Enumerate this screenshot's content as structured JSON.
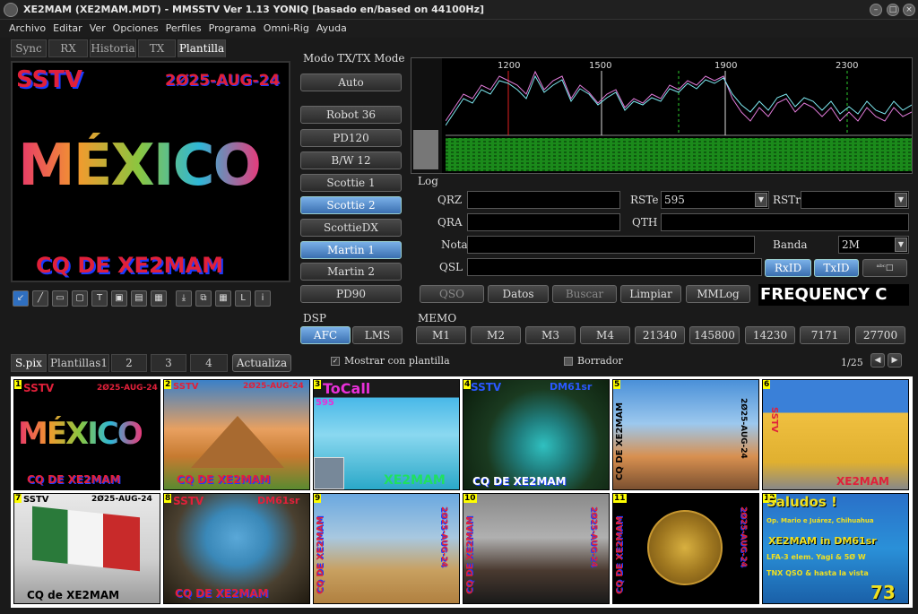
{
  "window": {
    "title": "XE2MAM (XE2MAM.MDT) - MMSSTV Ver 1.13 YONIQ [basado en/based on 44100Hz]"
  },
  "menu": [
    "Archivo",
    "Editar",
    "Ver",
    "Opciones",
    "Perfiles",
    "Programa",
    "Omni-Rig",
    "Ayuda"
  ],
  "tabs": [
    "Sync",
    "RX",
    "Historia",
    "TX",
    "Plantilla"
  ],
  "main_image": {
    "top_left": "SSTV",
    "top_right": "2Ø25-AUG-24",
    "center": "MÉXICO",
    "bottom": "CQ DE XE2MAM"
  },
  "mode": {
    "title": "Modo TX/TX Mode",
    "auto": "Auto",
    "modes": [
      "Robot 36",
      "PD120",
      "B/W 12",
      "Scottie 1",
      "Scottie 2",
      "ScottieDX",
      "Martin 1",
      "Martin 2",
      "PD90"
    ],
    "selected": [
      "Scottie 2",
      "Martin 1"
    ]
  },
  "spectrum": {
    "ticks": [
      "1200",
      "1500",
      "1900",
      "2300"
    ]
  },
  "log": {
    "title": "Log",
    "qrz_label": "QRZ",
    "qrz": "",
    "rste_label": "RSTe",
    "rste": "595",
    "rstr_label": "RSTr",
    "rstr": "",
    "qra_label": "QRA",
    "qra": "",
    "qth_label": "QTH",
    "qth": "",
    "nota_label": "Nota",
    "nota": "",
    "banda_label": "Banda",
    "banda": "2M",
    "qsl_label": "QSL",
    "qsl": "",
    "rxid": "RxID",
    "txid": "TxID",
    "buttons": [
      "QSO",
      "Datos",
      "Buscar",
      "Limpiar",
      "MMLog"
    ],
    "frequency": "FREQUENCY C"
  },
  "dsp": {
    "title": "DSP",
    "afc": "AFC",
    "lms": "LMS"
  },
  "memo": {
    "title": "MEMO",
    "items": [
      "M1",
      "M2",
      "M3",
      "M4",
      "21340",
      "145800",
      "14230",
      "7171",
      "27700"
    ]
  },
  "bottom_tabs": [
    "S.pix",
    "Plantillas1",
    "2",
    "3",
    "4"
  ],
  "actualiza": "Actualiza",
  "show_template": "Mostrar con plantilla",
  "borrador": "Borrador",
  "page": "1/25",
  "thumbs": [
    {
      "n": "1",
      "a": "SSTV",
      "b": "2Ø25-AUG-24",
      "c": "CQ DE XE2MAM",
      "d": "MÉXICO"
    },
    {
      "n": "2",
      "a": "SSTV",
      "b": "2Ø25-AUG-24",
      "c": "CQ DE XE2MAM"
    },
    {
      "n": "3",
      "a": "ToCall",
      "b": "595",
      "c": "XE2MAM"
    },
    {
      "n": "4",
      "a": "SSTV",
      "b": "DM61sr",
      "c": "CQ DE XE2MAM"
    },
    {
      "n": "5",
      "a": "CQ DE XE2MAM",
      "b": "2Ø25-AUG-24"
    },
    {
      "n": "6",
      "a": "SSTV",
      "b": "XE2MAM"
    },
    {
      "n": "7",
      "a": "SSTV",
      "b": "2Ø25-AUG-24",
      "c": "CQ de XE2MAM"
    },
    {
      "n": "8",
      "a": "SSTV",
      "b": "DM61sr",
      "c": "CQ DE XE2MAM"
    },
    {
      "n": "9",
      "a": "CQ DE XE2MAM",
      "b": "2Ø25-AUG-24"
    },
    {
      "n": "10",
      "a": "CQ DE XE2MAM",
      "b": "2Ø25-AUG-24"
    },
    {
      "n": "11",
      "a": "CQ DE XE2MAM",
      "b": "2Ø25-AUG-24"
    },
    {
      "n": "12",
      "a": "Saludos !",
      "b": "Op. Mario e Juárez, Chihuahua",
      "c": "XE2MAM in DM61sr",
      "d": "LFA-3 elem. Yagi & 5Ø W",
      "e": "TNX QSO & hasta la vista",
      "f": "73"
    }
  ],
  "colors": {
    "afc": "#3a6fb0",
    "wave_cyan": "#7de8f0",
    "wave_pink": "#e07ad8",
    "waterfall": "#1b8a1b"
  }
}
